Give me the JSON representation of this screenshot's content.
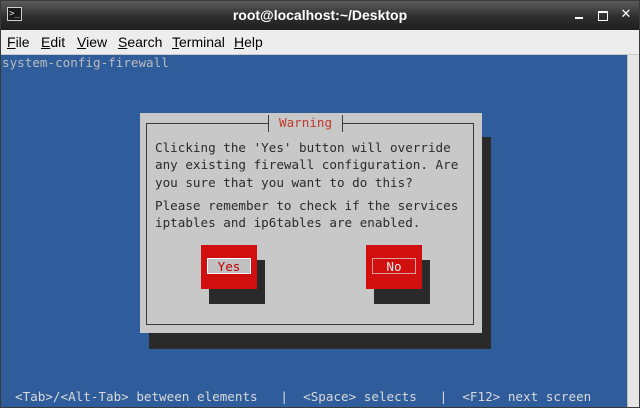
{
  "window": {
    "title": "root@localhost:~/Desktop",
    "icon": "terminal-icon",
    "controls": {
      "minimize_icon": "minimize-icon",
      "maximize_icon": "maximize-icon",
      "close_icon": "close-icon",
      "close_glyph": "✕"
    }
  },
  "menubar": {
    "items": [
      {
        "label": "File",
        "mnemonic": "F",
        "rest": "ile"
      },
      {
        "label": "Edit",
        "mnemonic": "E",
        "rest": "dit"
      },
      {
        "label": "View",
        "mnemonic": "V",
        "rest": "iew"
      },
      {
        "label": "Search",
        "mnemonic": "S",
        "rest": "earch"
      },
      {
        "label": "Terminal",
        "mnemonic": "T",
        "rest": "erminal"
      },
      {
        "label": "Help",
        "mnemonic": "H",
        "rest": "elp"
      }
    ]
  },
  "terminal": {
    "app_title": "system-config-firewall",
    "background": "#2f5d9c"
  },
  "dialog": {
    "title": "Warning",
    "message1": "Clicking the 'Yes' button will override\nany existing firewall configuration. Are\nyou sure that you want to do this?",
    "message2": "Please remember to check if the services\niptables and ip6tables are enabled.",
    "yes_label": "Yes",
    "no_label": "No",
    "title_color": "#c0392b",
    "button_color": "#d10f0f"
  },
  "help_line": "<Tab>/<Alt-Tab> between elements   |  <Space> selects   |  <F12> next screen"
}
